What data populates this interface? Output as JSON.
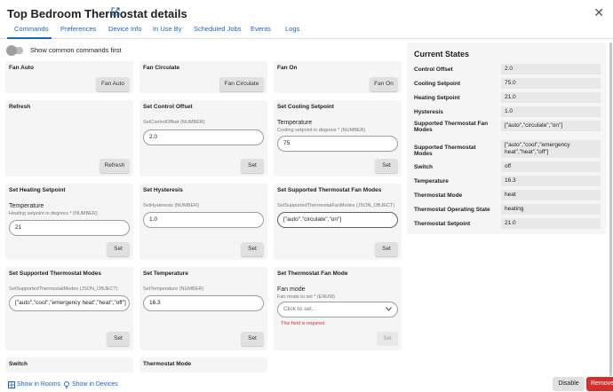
{
  "dialog": {
    "title": "Top Bedroom Thermostat details",
    "tabs": [
      "Commands",
      "Preferences",
      "Device Info",
      "In Use By",
      "Scheduled Jobs",
      "Events",
      "Logs"
    ]
  },
  "toggle": {
    "label": "Show common commands first"
  },
  "commands": {
    "fan_auto": {
      "title": "Fan Auto",
      "button": "Fan Auto"
    },
    "fan_circulate": {
      "title": "Fan Circulate",
      "button": "Fan Circulate"
    },
    "fan_on": {
      "title": "Fan On",
      "button": "Fan On"
    },
    "refresh": {
      "title": "Refresh",
      "button": "Refresh"
    },
    "set_control_offset": {
      "title": "Set Control Offset",
      "param_label": "SetControlOffset (NUMBER)",
      "value": "2.0",
      "button": "Set"
    },
    "set_cooling_setpoint": {
      "title": "Set Cooling Setpoint",
      "param": "Temperature",
      "param_label": "Cooling setpoint in degrees * (NUMBER)",
      "value": "75",
      "button": "Set"
    },
    "set_heating_setpoint": {
      "title": "Set Heating Setpoint",
      "param": "Temperature",
      "param_label": "Heating setpoint in degrees * (NUMBER)",
      "value": "21",
      "button": "Set"
    },
    "set_hysteresis": {
      "title": "Set Hysteresis",
      "param_label": "SetHysteresis (NUMBER)",
      "value": "1.0",
      "button": "Set"
    },
    "set_supported_fan_modes": {
      "title": "Set Supported Thermostat Fan Modes",
      "param_label": "SetSupportedThermostatFanModes (JSON_OBJECT)",
      "value": "[\"auto\",\"circulate\",\"on\"]",
      "button": "Set"
    },
    "set_supported_modes": {
      "title": "Set Supported Thermostat Modes",
      "param_label": "SetSupportedThermostatModes (JSON_OBJECT)",
      "value": "[\"auto\",\"cool\",\"emergency heat\",\"heat\",\"off\"]",
      "button": "Set"
    },
    "set_temperature": {
      "title": "Set Temperature",
      "param_label": "SetTemperature (NUMBER)",
      "value": "16.3",
      "button": "Set"
    },
    "set_fan_mode": {
      "title": "Set Thermostat Fan Mode",
      "param": "Fan mode",
      "param_label": "Fan mode to set * (ENUM)",
      "placeholder": "Click to set...",
      "error": "This field is required",
      "button": "Set"
    },
    "switch": {
      "title": "Switch"
    },
    "thermostat_mode": {
      "title": "Thermostat Mode"
    }
  },
  "current_states": {
    "title": "Current States",
    "rows": [
      {
        "name": "Control Offset",
        "value": "2.0"
      },
      {
        "name": "Cooling Setpoint",
        "value": "75.0"
      },
      {
        "name": "Heating Setpoint",
        "value": "21.0"
      },
      {
        "name": "Hysteresis",
        "value": "1.0"
      },
      {
        "name": "Supported Thermostat Fan Modes",
        "value": "[\"auto\",\"circulate\",\"on\"]"
      },
      {
        "name": "Supported Thermostat Modes",
        "value": "[\"auto\",\"cool\",\"emergency heat\",\"heat\",\"off\"]"
      },
      {
        "name": "Switch",
        "value": "off"
      },
      {
        "name": "Temperature",
        "value": "16.3"
      },
      {
        "name": "Thermostat Mode",
        "value": "heat"
      },
      {
        "name": "Thermostat Operating State",
        "value": "heating"
      },
      {
        "name": "Thermostat Setpoint",
        "value": "21.0"
      }
    ]
  },
  "footer": {
    "show_in_rooms": "Show in Rooms",
    "show_in_devices": "Show in Devices",
    "disable": "Disable",
    "remove": "Remove"
  },
  "colors": {
    "accent": "#1565c0",
    "danger": "#d32f2f",
    "card_bg": "#f5f5f5"
  }
}
